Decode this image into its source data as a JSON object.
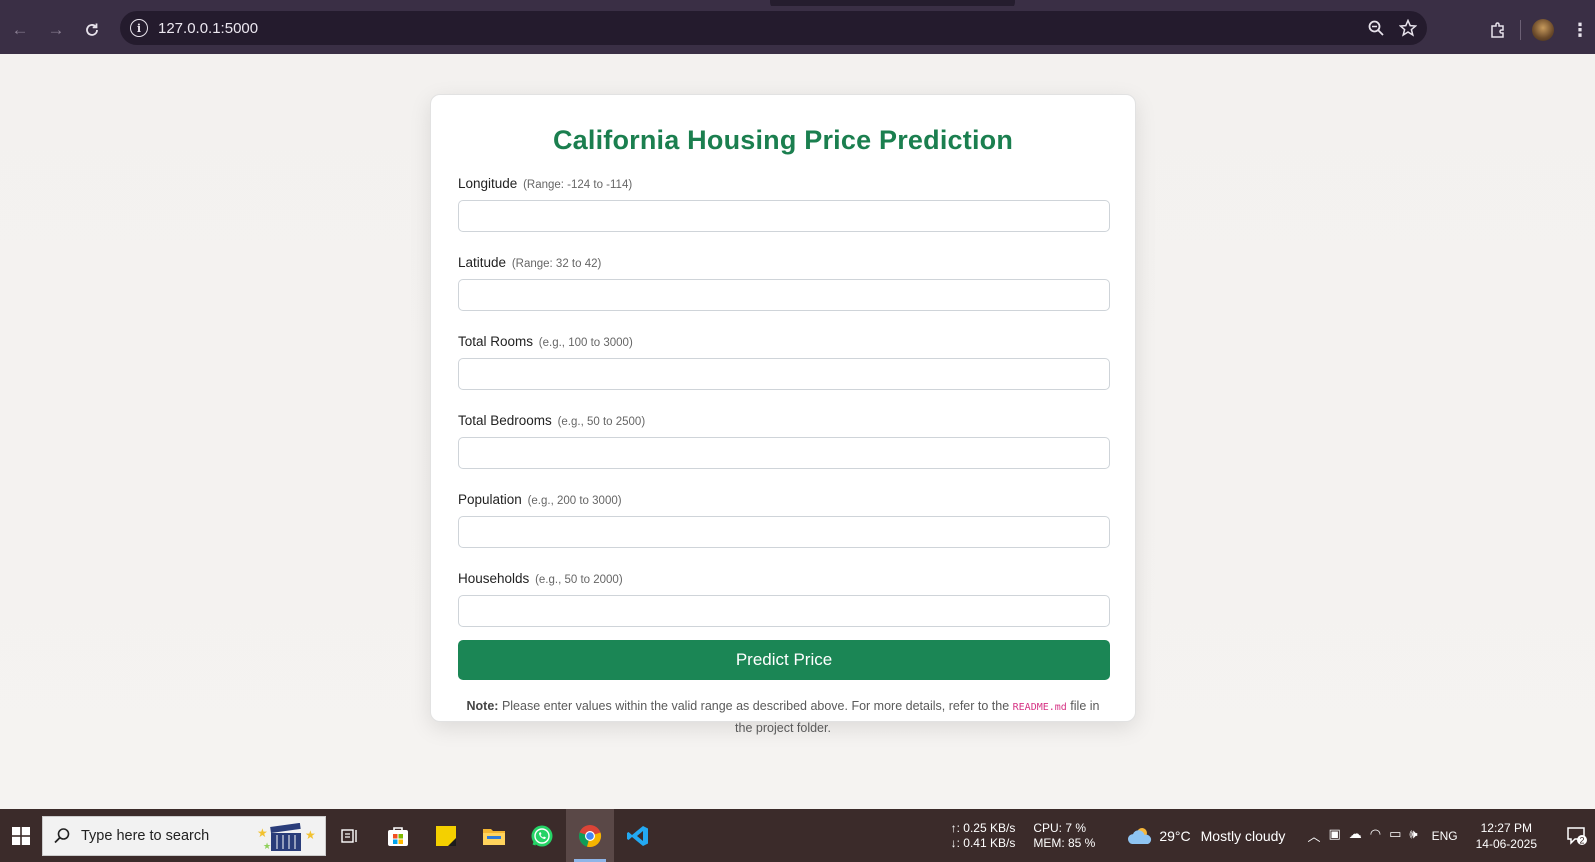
{
  "browser": {
    "url": "127.0.0.1:5000"
  },
  "form": {
    "title": "California Housing Price Prediction",
    "fields": [
      {
        "label": "Longitude",
        "hint": "(Range: -124 to -114)",
        "value": ""
      },
      {
        "label": "Latitude",
        "hint": "(Range: 32 to 42)",
        "value": ""
      },
      {
        "label": "Total Rooms",
        "hint": "(e.g., 100 to 3000)",
        "value": ""
      },
      {
        "label": "Total Bedrooms",
        "hint": "(e.g., 50 to 2500)",
        "value": ""
      },
      {
        "label": "Population",
        "hint": "(e.g., 200 to 3000)",
        "value": ""
      },
      {
        "label": "Households",
        "hint": "(e.g., 50 to 2000)",
        "value": ""
      }
    ],
    "submit_label": "Predict Price",
    "note": {
      "prefix": "Note:",
      "text_before": " Please enter values within the valid range as described above. For more details, refer to the ",
      "code": "README.md",
      "text_after": " file in the project folder."
    }
  },
  "taskbar": {
    "search_placeholder": "Type here to search",
    "net_up": "↑: 0.25 KB/s",
    "net_down": "↓: 0.41 KB/s",
    "cpu": "CPU: 7 %",
    "mem": "MEM: 85 %",
    "temperature": "29°C",
    "weather": "Mostly cloudy",
    "language": "ENG",
    "time": "12:27 PM",
    "date": "14-06-2025",
    "notification_count": "2"
  },
  "colors": {
    "accent": "#1b8655",
    "title": "#1b7f4f",
    "chrome": "#3a2f45"
  }
}
